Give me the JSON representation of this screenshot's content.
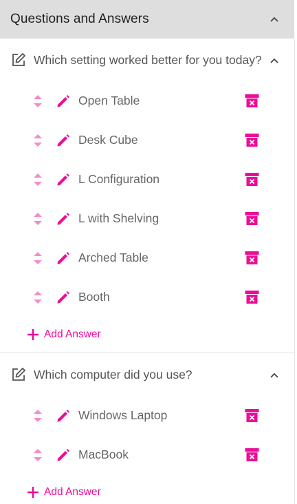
{
  "colors": {
    "accent": "#ec0c9a",
    "accent_light": "#f28ccb",
    "header_bg": "#dedede"
  },
  "panel": {
    "title": "Questions and Answers"
  },
  "questions": [
    {
      "text": "Which setting worked better for you today?",
      "answers": [
        "Open Table",
        "Desk Cube",
        "L Configuration",
        "L with Shelving",
        "Arched Table",
        "Booth"
      ],
      "add_label": "Add Answer"
    },
    {
      "text": "Which computer did you use?",
      "answers": [
        "Windows Laptop",
        "MacBook"
      ],
      "add_label": "Add Answer"
    }
  ]
}
